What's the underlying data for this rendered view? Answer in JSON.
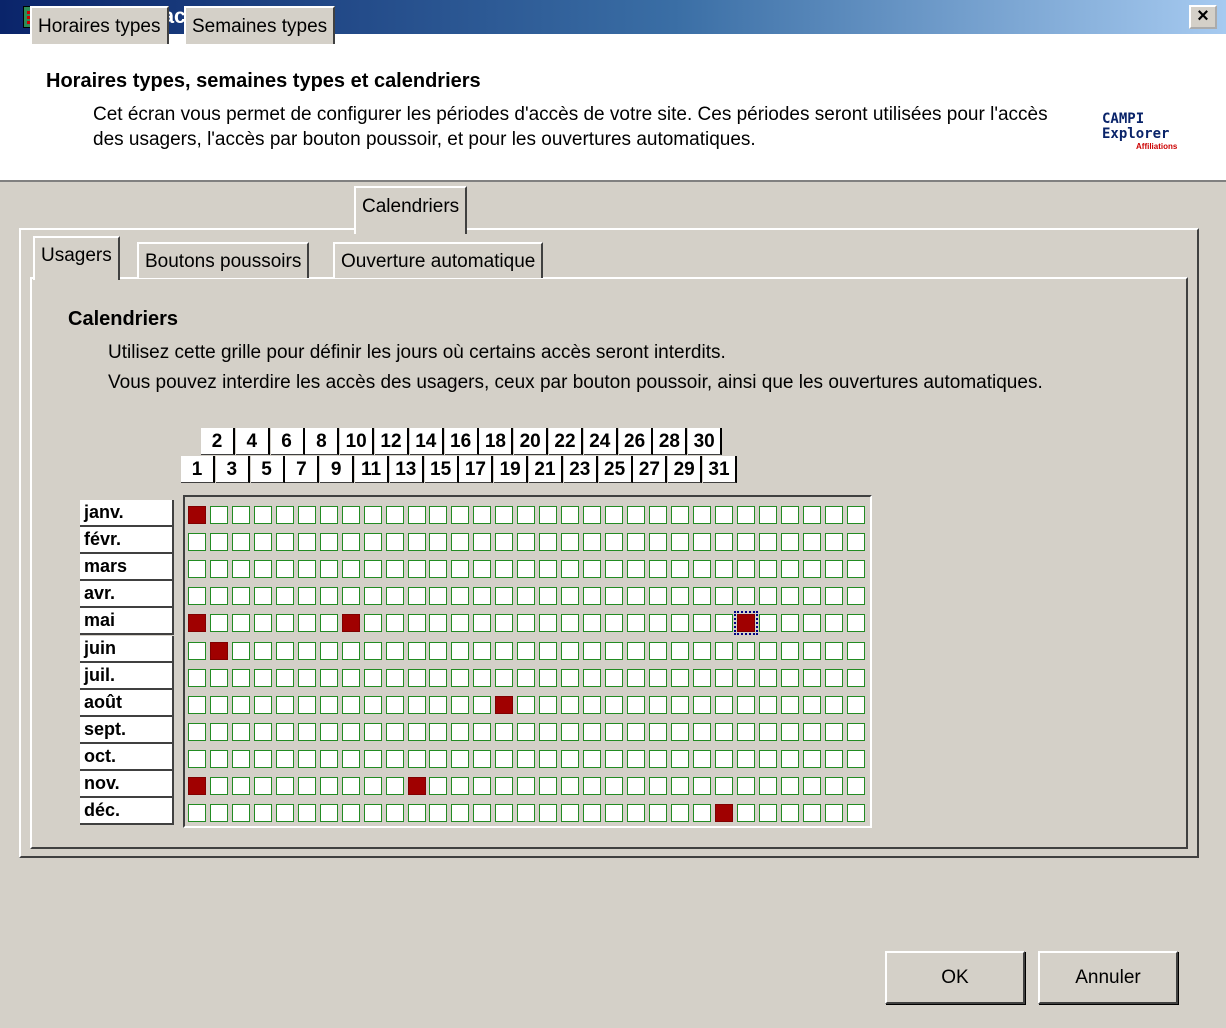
{
  "window": {
    "title": "Périodes d'accès du site",
    "close_symbol": "×"
  },
  "header": {
    "title": "Horaires types, semaines types et calendriers",
    "description": "Cet écran vous permet de configurer les périodes d'accès de votre site. Ces périodes seront utilisées pour l'accès des usagers, l'accès par bouton poussoir, et pour les ouvertures automatiques.",
    "logo": {
      "line1": "CAMPI",
      "line2": "Explorer",
      "line3": "Affiliations"
    }
  },
  "tabs": [
    {
      "label": "Horaires types"
    },
    {
      "label": "Semaines types"
    },
    {
      "label": "Calendriers",
      "active": true
    }
  ],
  "sub_tabs": [
    {
      "label": "Usagers",
      "active": true
    },
    {
      "label": "Boutons poussoirs"
    },
    {
      "label": "Ouverture automatique"
    }
  ],
  "section": {
    "title": "Calendriers",
    "line1": "Utilisez cette grille pour définir les jours où certains accès seront interdits.",
    "line2": "Vous pouvez interdire les accès des usagers, ceux par bouton poussoir, ainsi que les ouvertures automatiques."
  },
  "days": [
    1,
    2,
    3,
    4,
    5,
    6,
    7,
    8,
    9,
    10,
    11,
    12,
    13,
    14,
    15,
    16,
    17,
    18,
    19,
    20,
    21,
    22,
    23,
    24,
    25,
    26,
    27,
    28,
    29,
    30,
    31
  ],
  "months": [
    "janv.",
    "févr.",
    "mars",
    "avr.",
    "mai",
    "juin",
    "juil.",
    "août",
    "sept.",
    "oct.",
    "nov.",
    "déc."
  ],
  "forbidden_days": [
    {
      "month": "janv.",
      "day": 1
    },
    {
      "month": "mai",
      "day": 1
    },
    {
      "month": "mai",
      "day": 8
    },
    {
      "month": "mai",
      "day": 26
    },
    {
      "month": "juin",
      "day": 2
    },
    {
      "month": "août",
      "day": 15
    },
    {
      "month": "nov.",
      "day": 1
    },
    {
      "month": "nov.",
      "day": 11
    },
    {
      "month": "déc.",
      "day": 25
    }
  ],
  "focused_cell": {
    "month": "mai",
    "day": 26
  },
  "colors": {
    "forbidden": "#a00000",
    "allowed_border": "#228b22",
    "title_bar": "#0a246a"
  },
  "buttons": {
    "ok": "OK",
    "cancel": "Annuler"
  }
}
